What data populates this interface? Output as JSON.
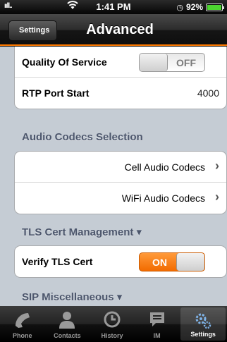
{
  "status_bar": {
    "signal": "ııll..",
    "time": "1:41 PM",
    "battery_percent": "92%",
    "battery_level": 0.92
  },
  "nav": {
    "back_label": "Settings",
    "title": "Advanced"
  },
  "qos": {
    "label": "Quality Of Service",
    "state": "OFF"
  },
  "rtp": {
    "label": "RTP Port Start",
    "value": "4000"
  },
  "audio_codecs": {
    "header": "Audio Codecs Selection",
    "items": [
      "Cell Audio Codecs",
      "WiFi Audio Codecs"
    ]
  },
  "tls": {
    "header": "TLS Cert Management ▾",
    "verify_label": "Verify TLS Cert",
    "verify_state": "ON"
  },
  "sip_misc": {
    "header": "SIP Miscellaneous ▾"
  },
  "tabbar": {
    "tabs": [
      "Phone",
      "Contacts",
      "History",
      "IM",
      "Settings"
    ],
    "active": "Settings"
  },
  "colors": {
    "accent": "#f26b00",
    "section_header": "#4c566c",
    "background": "#c5ccd4"
  },
  "icons": [
    "wifi-icon",
    "alarm-icon",
    "battery-icon",
    "phone-icon",
    "contacts-icon",
    "history-icon",
    "im-icon",
    "settings-icon",
    "chevron-right-icon"
  ]
}
